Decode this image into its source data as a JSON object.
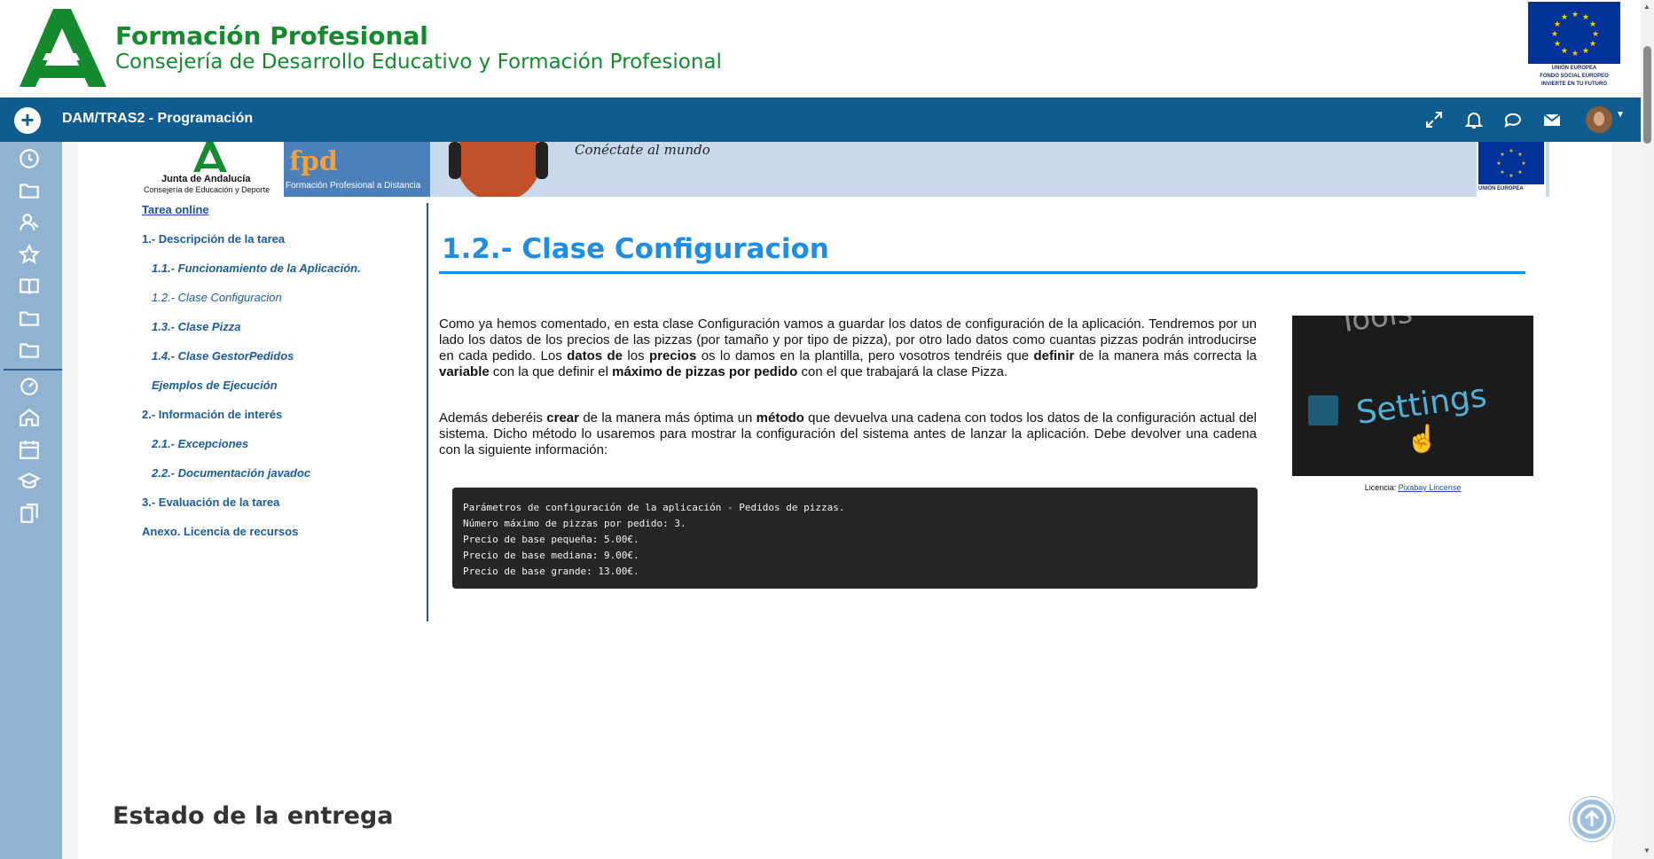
{
  "header": {
    "brand_title": "Formación Profesional",
    "brand_subtitle": "Consejería de Desarrollo Educativo y Formación Profesional",
    "eu_caption_1": "UNIÓN EUROPEA",
    "eu_caption_2": "FONDO SOCIAL EUROPEO",
    "eu_caption_3": "INVIERTE EN TU FUTURO"
  },
  "navbar": {
    "course_title": "DAM/TRAS2 - Programación",
    "icons": [
      "fullscreen-icon",
      "bell-icon",
      "chat-icon",
      "mail-icon"
    ],
    "color": "#0f5c91"
  },
  "rail": {
    "icons": [
      "clock-icon",
      "folder-icon",
      "users-icon",
      "star-icon",
      "book-icon",
      "folder-icon",
      "folder-icon",
      "dashboard-icon",
      "home-icon",
      "calendar-icon",
      "graduation-icon",
      "files-icon"
    ]
  },
  "banner": {
    "ja_name": "Junta de Andalucía",
    "ja_sub": "Consejería de Educación y Deporte",
    "fpd_text": "Formación Profesional a Distancia",
    "slogan": "Conéctate al mundo",
    "eu_caption": "UNIÓN EUROPEA"
  },
  "toc": {
    "items": [
      {
        "label": "Tarea online"
      },
      {
        "label": "1.- Descripción de la tarea"
      },
      {
        "label": "1.1.- Funcionamiento de la Aplicación."
      },
      {
        "label": "1.2.- Clase Configuracion"
      },
      {
        "label": "1.3.- Clase Pizza"
      },
      {
        "label": "1.4.- Clase GestorPedidos"
      },
      {
        "label": "Ejemplos de Ejecución"
      },
      {
        "label": "2.- Información de interés"
      },
      {
        "label": "2.1.- Excepciones"
      },
      {
        "label": "2.2.- Documentación javadoc"
      },
      {
        "label": "3.- Evaluación de la tarea"
      },
      {
        "label": "Anexo. Licencia de recursos"
      }
    ]
  },
  "article": {
    "title": "1.2.- Clase Configuracion",
    "accent": "#1f8de0",
    "p1_a": "Como ya hemos comentado, en esta clase Configuración vamos a guardar los datos de configuración de la aplicación. Tendremos por un lado los datos de los precios de las pizzas (por tamaño y por tipo de pizza), por otro lado datos como cuantas pizzas podrán introducirse en cada pedido. Los ",
    "p1_b": "datos de",
    "p1_c": " los ",
    "p1_d": "precios",
    "p1_e": " os lo damos en la plantilla, pero vosotros tendréis que ",
    "p1_f": "definir",
    "p1_g": " de la manera más correcta la ",
    "p1_h": "variable",
    "p1_i": " con la que definir el ",
    "p1_j": "máximo de pizzas por pedido",
    "p1_k": " con el que trabajará la clase Pizza.",
    "p2_a": "Además deberéis ",
    "p2_b": "crear",
    "p2_c": " de la manera más óptima un ",
    "p2_d": "método",
    "p2_e": " que devuelva una cadena con todos los datos de la configuración actual del sistema. Dicho método lo usaremos para mostrar la configuración del sistema antes de lanzar la aplicación. Debe devolver una cadena con la siguiente información:",
    "code": [
      "Parámetros de configuración de la aplicación - Pedidos de pizzas.",
      "Número máximo de pizzas por pedido: 3.",
      "Precio de base pequeña: 5.00€.",
      "Precio de base mediana: 9.00€.",
      "Precio de base grande: 13.00€."
    ],
    "image_words": {
      "tools": "Tools",
      "settings": "Settings"
    },
    "license_label": "Licencia: ",
    "license_link": "Pixabay Lincense"
  },
  "estado_title": "Estado de la entrega"
}
